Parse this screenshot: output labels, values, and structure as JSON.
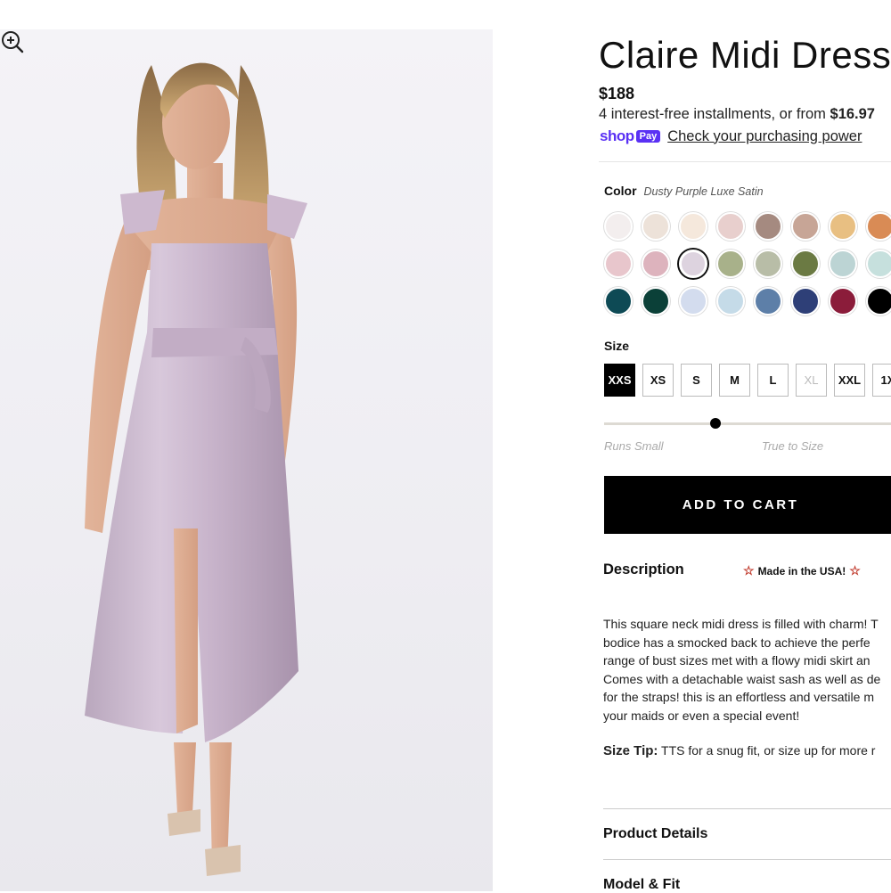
{
  "product": {
    "title": "Claire Midi Dress",
    "price": "$188",
    "installments_text": "4 interest-free installments, or from ",
    "installments_amount": "$16.97",
    "shoppay_shop": "shop",
    "shoppay_pay": "Pay",
    "purchasing_power_link": "Check your purchasing power"
  },
  "color": {
    "label": "Color",
    "selected_name": "Dusty Purple Luxe Satin",
    "swatches": [
      [
        "#f3eeee",
        "#ede2d9",
        "#f5e8dc",
        "#e8cfcd",
        "#a58a80",
        "#c7a596",
        "#e8bf82",
        "#d98b55"
      ],
      [
        "#e8c6cc",
        "#ddb3bd",
        "#ddd3df",
        "#a8b18a",
        "#b8bda7",
        "#6b7a43",
        "#bcd4d4",
        "#c6e0dd"
      ],
      [
        "#0e4a55",
        "#0b4038",
        "#d3dcee",
        "#c5dbe8",
        "#5d7fa8",
        "#2e3f77",
        "#8b1c3a",
        "#000000"
      ]
    ],
    "selected_row": 1,
    "selected_col": 2
  },
  "size": {
    "label": "Size",
    "options": [
      "XXS",
      "XS",
      "S",
      "M",
      "L",
      "XL",
      "XXL",
      "1X"
    ],
    "selected": "XXS",
    "unavailable": [
      "XL"
    ]
  },
  "fit": {
    "left_label": "Runs Small",
    "center_label": "True to Size",
    "value_fraction": 0.38
  },
  "add_to_cart": "ADD TO CART",
  "description": {
    "heading": "Description",
    "badge": "Made in the USA!",
    "lines": [
      "This square neck midi dress is filled with charm! T",
      "bodice has a smocked back to achieve the perfe",
      "range of bust sizes met with a flowy midi skirt an",
      "Comes with a detachable waist sash as well as de",
      "for the straps! this is an effortless and versatile m",
      "your maids or even a special event!"
    ],
    "tip_label": "Size Tip:",
    "tip_text": " TTS for a snug fit, or size up for more r"
  },
  "accordions": {
    "details": "Product Details",
    "model_fit": "Model & Fit"
  },
  "icons": {
    "zoom": "zoom-in-icon",
    "star": "star-icon"
  }
}
